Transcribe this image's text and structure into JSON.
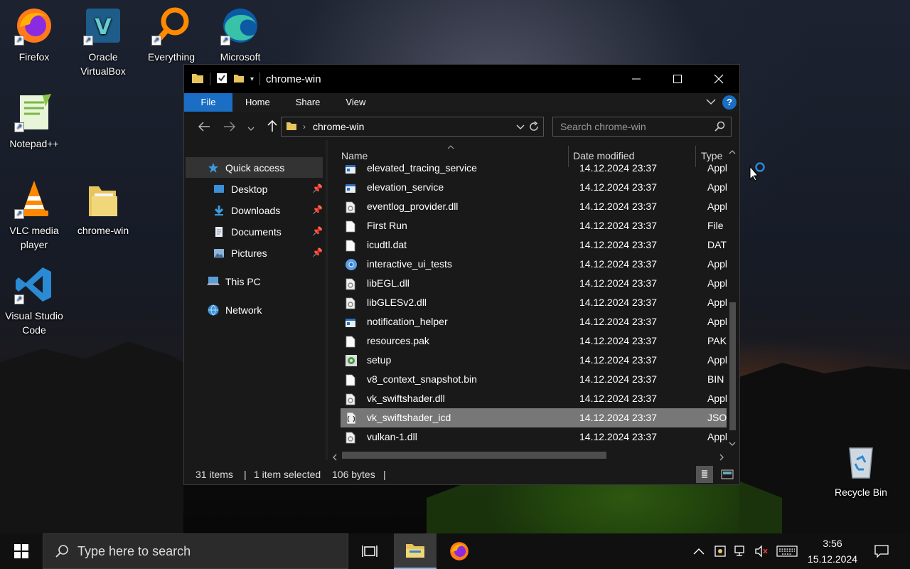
{
  "desktop": {
    "icons": [
      {
        "label": "Firefox"
      },
      {
        "label": "Oracle VirtualBox"
      },
      {
        "label": "Everything"
      },
      {
        "label": "Microsoft"
      },
      {
        "label": "Notepad++"
      },
      {
        "label": "VLC media player"
      },
      {
        "label": "chrome-win"
      },
      {
        "label": "Visual Studio Code"
      },
      {
        "label": "Recycle Bin"
      }
    ]
  },
  "window": {
    "title": "chrome-win",
    "ribbon_tabs": [
      "File",
      "Home",
      "Share",
      "View"
    ],
    "help": "?",
    "address": "chrome-win",
    "search_placeholder": "Search chrome-win",
    "nav_pane": {
      "quick_access": "Quick access",
      "desktop": "Desktop",
      "downloads": "Downloads",
      "documents": "Documents",
      "pictures": "Pictures",
      "this_pc": "This PC",
      "network": "Network"
    },
    "columns": {
      "name": "Name",
      "date": "Date modified",
      "type": "Type"
    },
    "files": [
      {
        "name": "elevated_tracing_service",
        "date": "14.12.2024 23:37",
        "type": "Appli",
        "icon": "app-icon"
      },
      {
        "name": "elevation_service",
        "date": "14.12.2024 23:37",
        "type": "Appli",
        "icon": "app-icon"
      },
      {
        "name": "eventlog_provider.dll",
        "date": "14.12.2024 23:37",
        "type": "Appli",
        "icon": "dll-icon"
      },
      {
        "name": "First Run",
        "date": "14.12.2024 23:37",
        "type": "File",
        "icon": "file-icon"
      },
      {
        "name": "icudtl.dat",
        "date": "14.12.2024 23:37",
        "type": "DAT F",
        "icon": "file-icon"
      },
      {
        "name": "interactive_ui_tests",
        "date": "14.12.2024 23:37",
        "type": "Appli",
        "icon": "chromium-icon"
      },
      {
        "name": "libEGL.dll",
        "date": "14.12.2024 23:37",
        "type": "Appli",
        "icon": "dll-icon"
      },
      {
        "name": "libGLESv2.dll",
        "date": "14.12.2024 23:37",
        "type": "Appli",
        "icon": "dll-icon"
      },
      {
        "name": "notification_helper",
        "date": "14.12.2024 23:37",
        "type": "Appli",
        "icon": "app-icon"
      },
      {
        "name": "resources.pak",
        "date": "14.12.2024 23:37",
        "type": "PAK F",
        "icon": "file-icon"
      },
      {
        "name": "setup",
        "date": "14.12.2024 23:37",
        "type": "Appli",
        "icon": "setup-icon"
      },
      {
        "name": "v8_context_snapshot.bin",
        "date": "14.12.2024 23:37",
        "type": "BIN F",
        "icon": "file-icon"
      },
      {
        "name": "vk_swiftshader.dll",
        "date": "14.12.2024 23:37",
        "type": "Appli",
        "icon": "dll-icon"
      },
      {
        "name": "vk_swiftshader_icd",
        "date": "14.12.2024 23:37",
        "type": "JSON",
        "icon": "json-icon",
        "selected": true
      },
      {
        "name": "vulkan-1.dll",
        "date": "14.12.2024 23:37",
        "type": "Appli",
        "icon": "dll-icon"
      }
    ],
    "status": {
      "count": "31 items",
      "selected": "1 item selected",
      "size": "106 bytes"
    }
  },
  "taskbar": {
    "search_placeholder": "Type here to search",
    "time": "3:56",
    "date": "15.12.2024"
  },
  "colors": {
    "accent": "#1a6fc4",
    "selection": "#777777",
    "window_bg": "#191919"
  }
}
